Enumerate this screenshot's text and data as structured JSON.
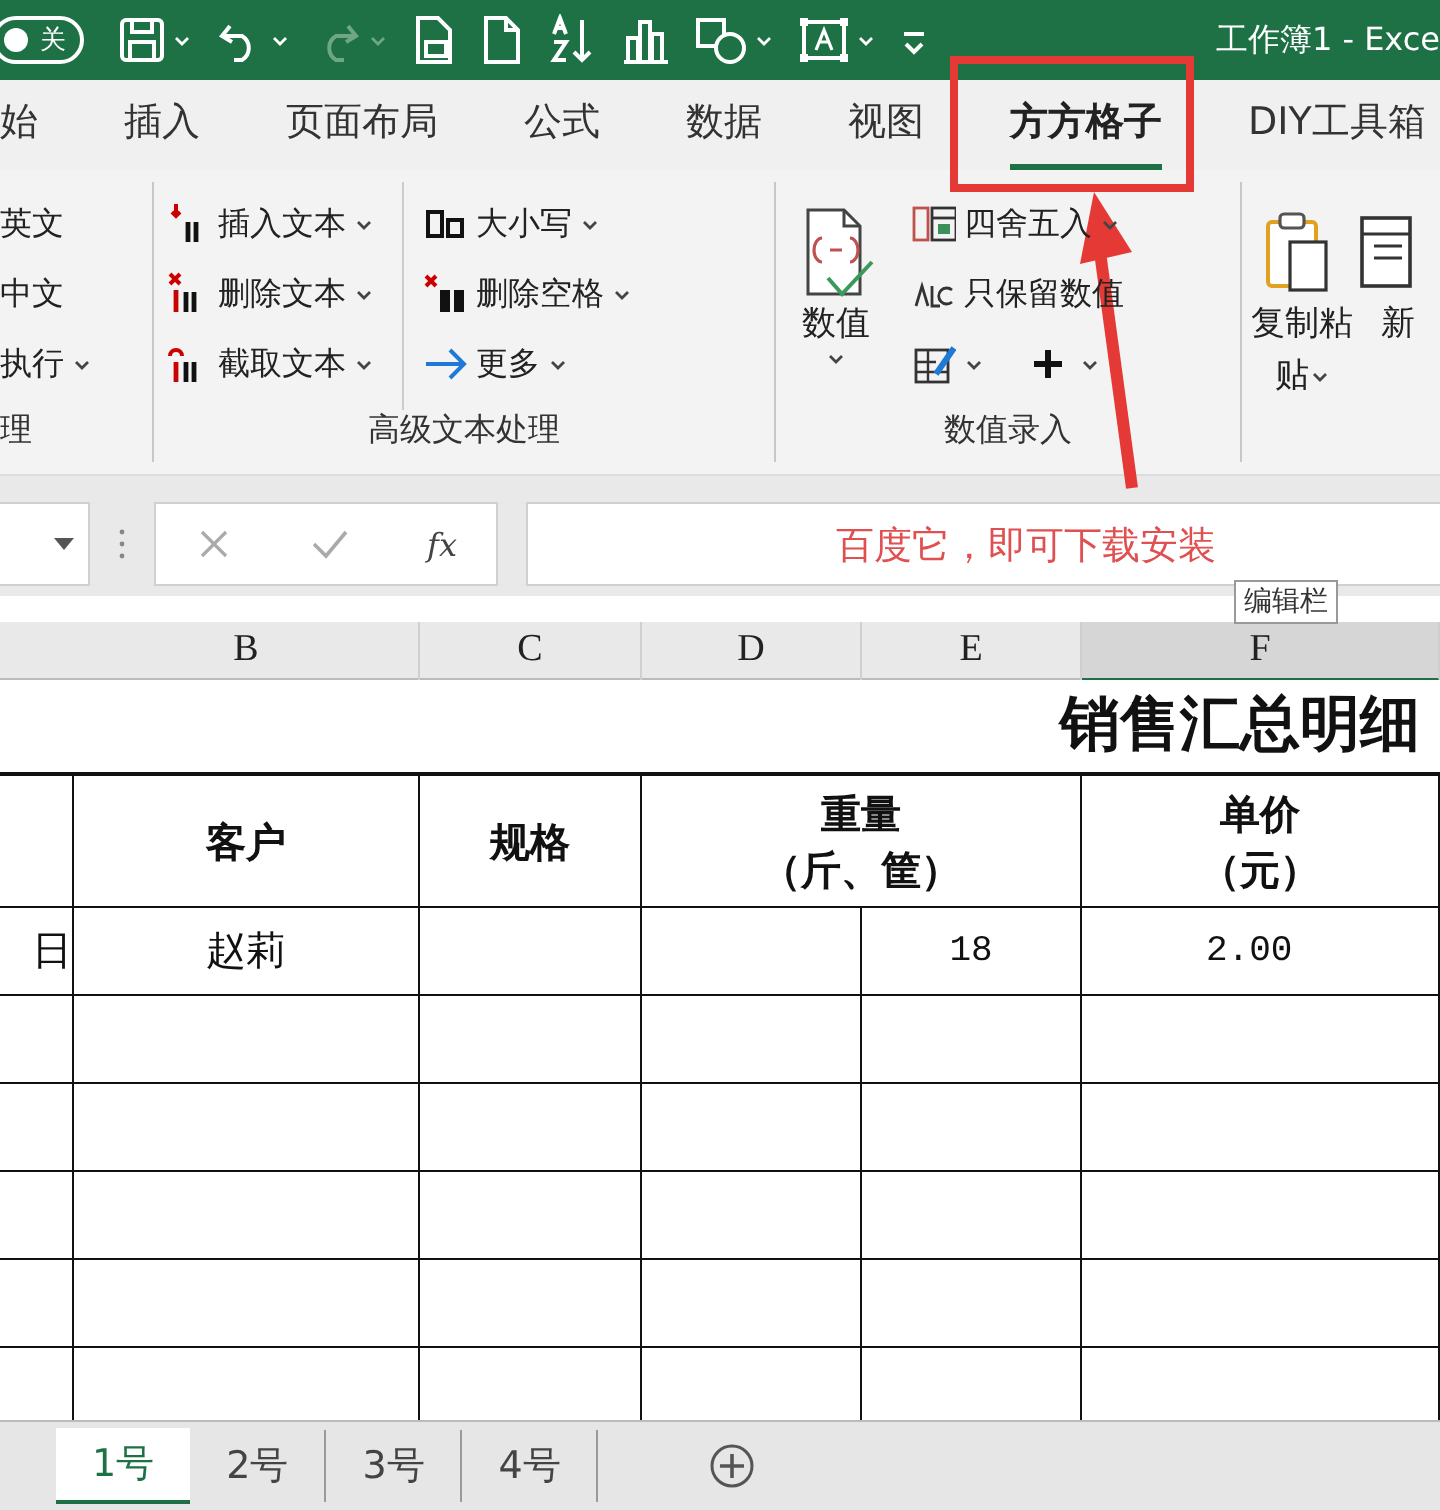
{
  "title_bar": {
    "autosave": {
      "label": "关",
      "on": false
    },
    "title": "工作簿1 - Exce"
  },
  "ribbon_tabs": [
    {
      "label": "始",
      "selected": false
    },
    {
      "label": "插入",
      "selected": false
    },
    {
      "label": "页面布局",
      "selected": false
    },
    {
      "label": "公式",
      "selected": false
    },
    {
      "label": "数据",
      "selected": false
    },
    {
      "label": "视图",
      "selected": false
    },
    {
      "label": "方方格子",
      "selected": true
    },
    {
      "label": "DIY工具箱",
      "selected": false
    }
  ],
  "ribbon_groups": [
    {
      "label": "理",
      "columns": [
        [
          {
            "kind": "small",
            "label": "英文",
            "dropdown": false
          },
          {
            "kind": "small",
            "label": "中文",
            "dropdown": false
          },
          {
            "kind": "small",
            "label": "执行",
            "dropdown": true
          }
        ]
      ]
    },
    {
      "label": "高级文本处理",
      "columns": [
        [
          {
            "kind": "small",
            "label": "插入文本",
            "dropdown": true
          },
          {
            "kind": "small",
            "label": "删除文本",
            "dropdown": true
          },
          {
            "kind": "small",
            "label": "截取文本",
            "dropdown": true
          }
        ],
        [
          {
            "kind": "small",
            "label": "大小写",
            "dropdown": true
          },
          {
            "kind": "small",
            "label": "删除空格",
            "dropdown": true
          },
          {
            "kind": "small",
            "label": "更多",
            "dropdown": true
          }
        ]
      ]
    },
    {
      "label": "数值录入",
      "columns": [
        [
          {
            "kind": "large",
            "label": "数值",
            "dropdown": true
          }
        ],
        [
          {
            "kind": "small",
            "label": "四舍五入",
            "dropdown": true
          },
          {
            "kind": "small",
            "label": "只保留数值",
            "dropdown": false
          },
          {
            "kind": "icon",
            "dropdown": true
          },
          {
            "kind": "icon",
            "dropdown": true
          }
        ]
      ]
    },
    {
      "columns": [
        [
          {
            "kind": "large",
            "label": "复制粘贴",
            "dropdown": true
          }
        ],
        [
          {
            "kind": "large",
            "label": "新",
            "dropdown": false
          }
        ]
      ]
    }
  ],
  "formula_bar": {
    "function_label": "fx"
  },
  "annotation": {
    "note": "百度它，即可下载安装"
  },
  "tooltip": "编辑栏",
  "column_headers": [
    {
      "label": "B",
      "selected": false
    },
    {
      "label": "C",
      "selected": false
    },
    {
      "label": "D",
      "selected": false
    },
    {
      "label": "E",
      "selected": false
    },
    {
      "label": "F",
      "selected": true
    }
  ],
  "sheet": {
    "title": "销售汇总明细",
    "header": [
      {
        "kind": "single"
      },
      {
        "kind": "single",
        "lines": [
          "客户"
        ]
      },
      {
        "kind": "single",
        "lines": [
          "规格"
        ]
      },
      {
        "kind": "merged",
        "lines": [
          "重量",
          "（斤、筐）"
        ]
      },
      {
        "kind": "single",
        "lines": [
          "单价",
          "（元）"
        ]
      }
    ],
    "rows": [
      [
        "日",
        "赵莉",
        "",
        "",
        "18",
        "2.00"
      ]
    ]
  },
  "sheet_tabs": [
    {
      "label": "1号",
      "selected": true
    },
    {
      "label": "2号",
      "selected": false
    },
    {
      "label": "3号",
      "selected": false
    },
    {
      "label": "4号",
      "selected": false
    }
  ]
}
